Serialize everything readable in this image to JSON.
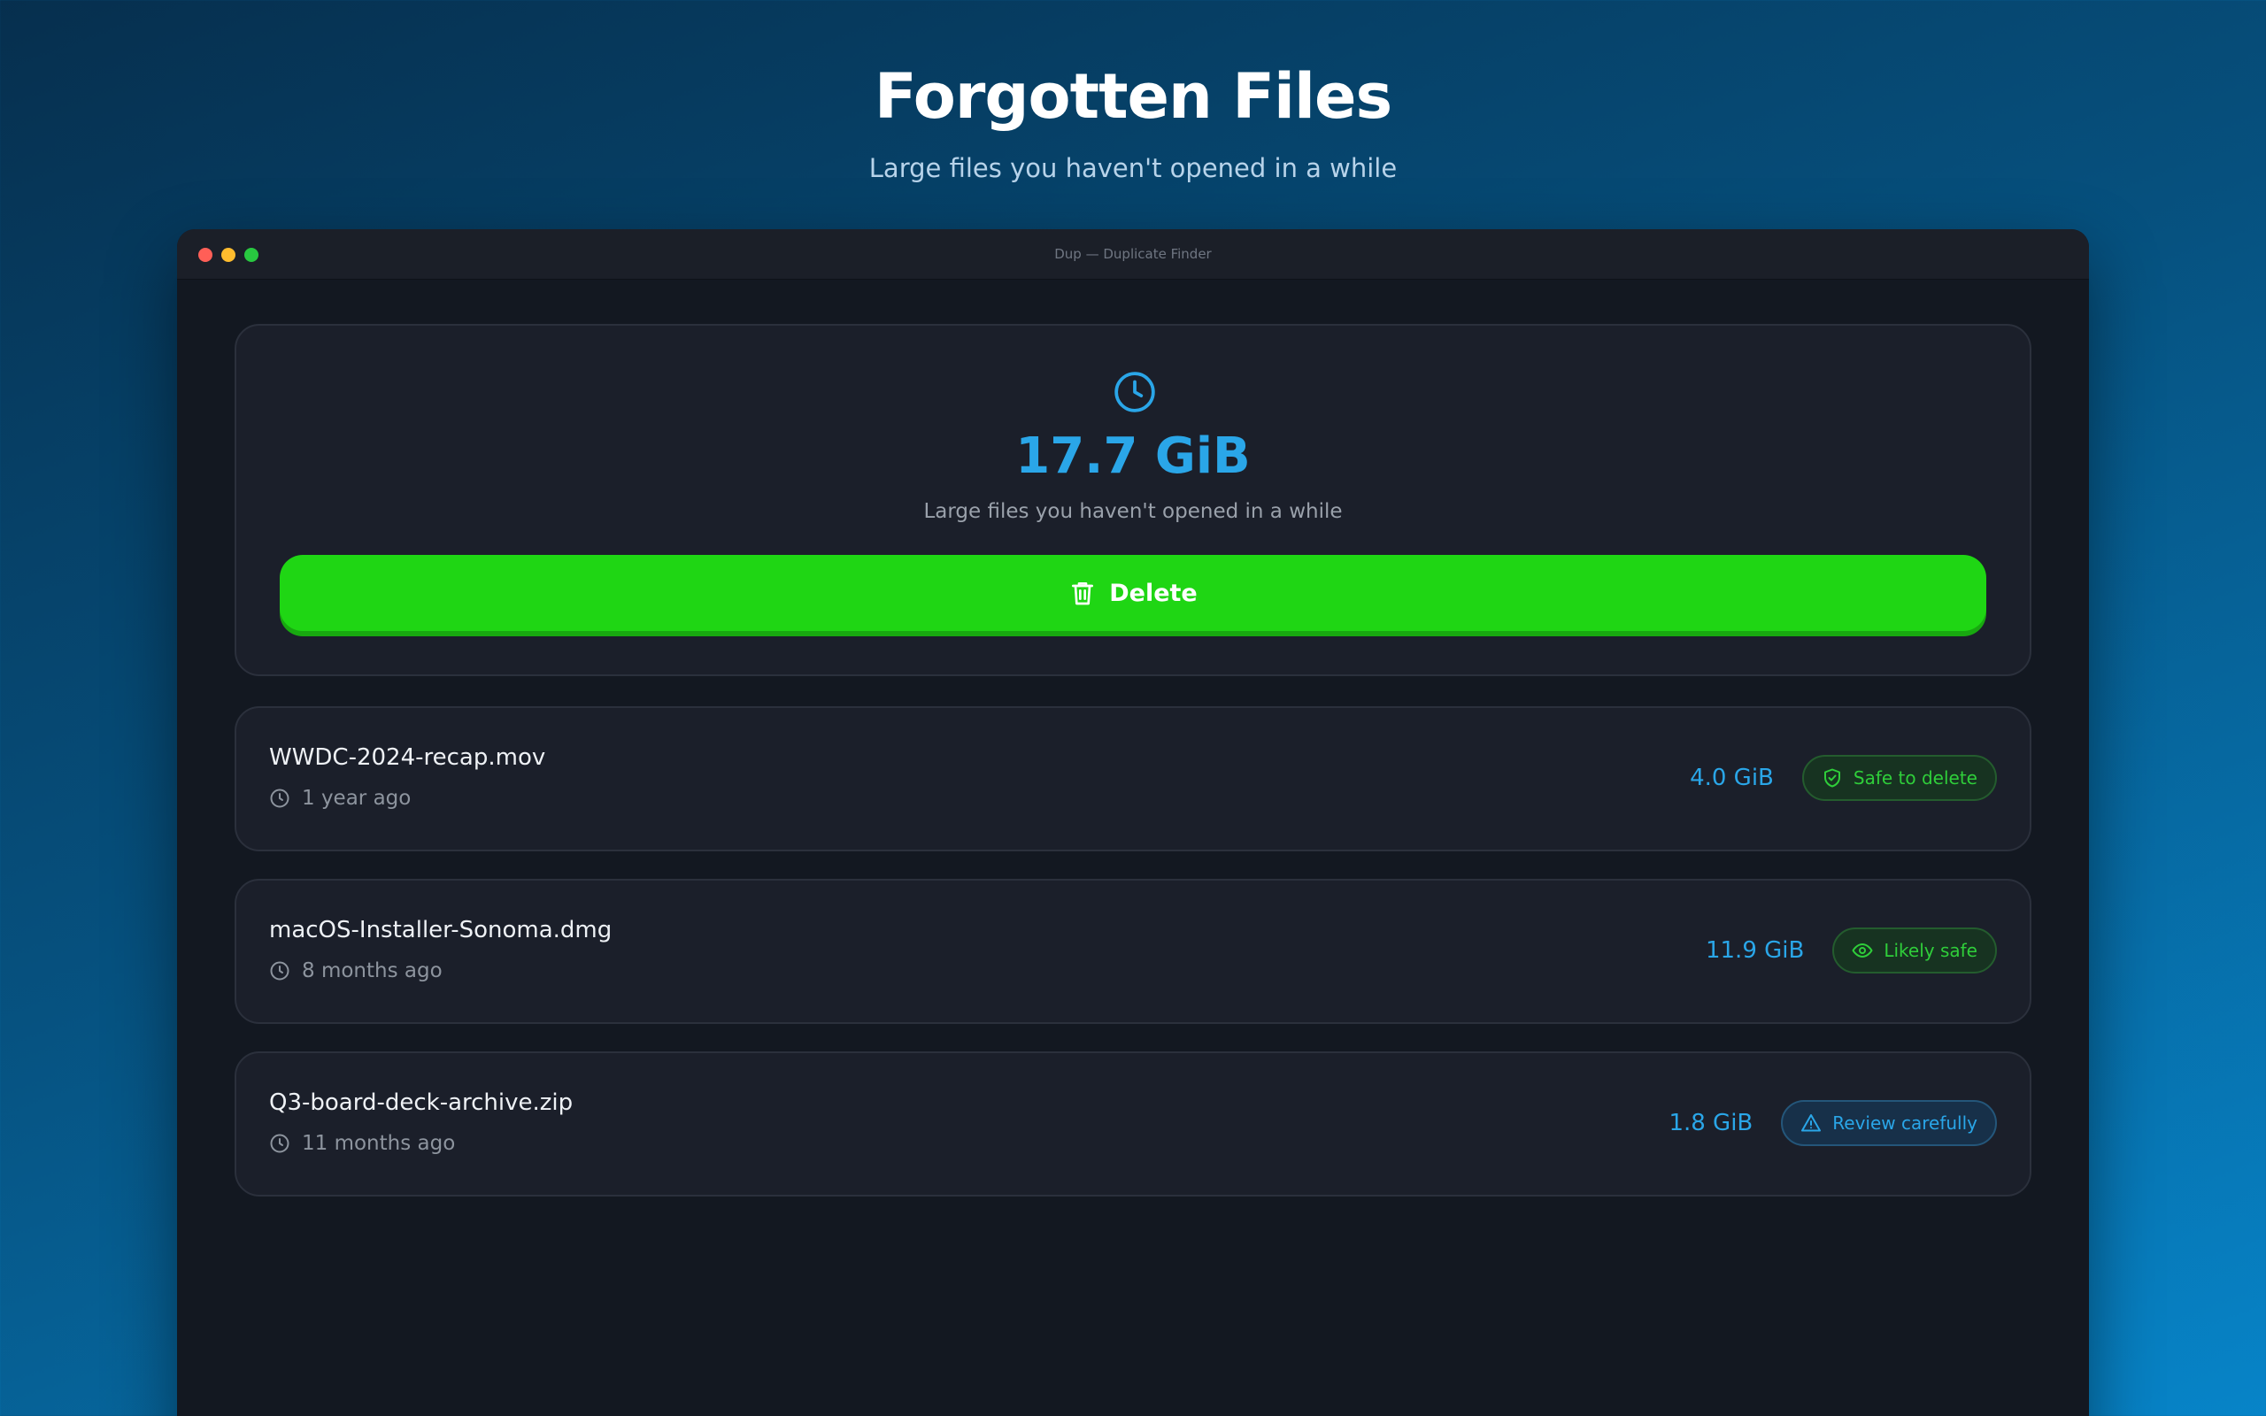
{
  "hero": {
    "title": "Forgotten Files",
    "subtitle": "Large files you haven't opened in a while"
  },
  "window": {
    "title": "Dup — Duplicate Finder"
  },
  "summary": {
    "icon": "clock-icon",
    "total_size": "17.7 GiB",
    "description": "Large files you haven't opened in a while",
    "delete_label": "Delete",
    "delete_icon": "trash-icon"
  },
  "files": [
    {
      "name": "WWDC-2024-recap.mov",
      "age": "1 year ago",
      "size": "4.0 GiB",
      "badge": "Safe to delete",
      "badge_icon": "shield-check-icon"
    },
    {
      "name": "macOS-Installer-Sonoma.dmg",
      "age": "8 months ago",
      "size": "11.9 GiB",
      "badge": "Likely safe",
      "badge_icon": "eye-icon"
    },
    {
      "name": "Q3-board-deck-archive.zip",
      "age": "11 months ago",
      "size": "1.8 GiB",
      "badge": "Review carefully",
      "badge_icon": "warning-triangle-icon"
    }
  ],
  "colors": {
    "accent_blue": "#2aa6e8",
    "delete_green": "#1fd614",
    "safe_green": "#2fce3a",
    "window_bg": "#131821",
    "card_bg": "#1b1f2a"
  }
}
